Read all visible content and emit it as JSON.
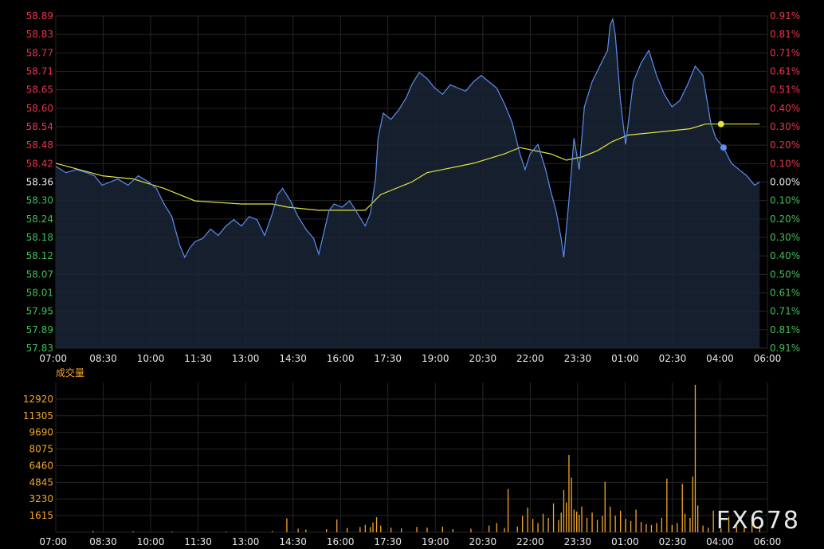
{
  "watermark": "FX678",
  "volume_title": "成交量",
  "colors": {
    "background": "#000000",
    "grid": "#262626",
    "price_line": "#5b8ff0",
    "price_fill": "#1a2535",
    "avg_line": "#e3e340",
    "up_label": "#e8344a",
    "down_label": "#3fbf5a",
    "neutral_label": "#e8e8e8",
    "volume_bar": "#f5a623"
  },
  "chart_data": [
    {
      "type": "line",
      "x_ticks": [
        "07:00",
        "08:30",
        "10:00",
        "11:30",
        "13:00",
        "14:30",
        "16:00",
        "17:30",
        "19:00",
        "20:30",
        "22:00",
        "23:30",
        "01:00",
        "02:30",
        "04:00",
        "06:00"
      ],
      "y_ticks_left": [
        "58.89",
        "58.83",
        "58.77",
        "58.71",
        "58.65",
        "58.60",
        "58.54",
        "58.48",
        "58.42",
        "58.36",
        "58.30",
        "58.24",
        "58.18",
        "58.12",
        "58.07",
        "58.01",
        "57.95",
        "57.89",
        "57.83"
      ],
      "y_ticks_right": [
        "0.91%",
        "0.81%",
        "0.71%",
        "0.61%",
        "0.51%",
        "0.40%",
        "0.30%",
        "0.20%",
        "0.10%",
        "0.00%",
        "0.10%",
        "0.20%",
        "0.30%",
        "0.40%",
        "0.50%",
        "0.61%",
        "0.71%",
        "0.81%",
        "0.91%"
      ],
      "ylim": [
        57.83,
        58.89
      ],
      "reference": 58.36,
      "series": [
        {
          "role": "price",
          "points": [
            [
              "07:00",
              58.41
            ],
            [
              "07:20",
              58.39
            ],
            [
              "07:40",
              58.4
            ],
            [
              "08:00",
              58.39
            ],
            [
              "08:15",
              58.38
            ],
            [
              "08:30",
              58.35
            ],
            [
              "08:45",
              58.36
            ],
            [
              "09:00",
              58.37
            ],
            [
              "09:20",
              58.35
            ],
            [
              "09:40",
              58.38
            ],
            [
              "10:00",
              58.36
            ],
            [
              "10:15",
              58.34
            ],
            [
              "10:30",
              58.29
            ],
            [
              "10:45",
              58.25
            ],
            [
              "11:00",
              58.16
            ],
            [
              "11:10",
              58.12
            ],
            [
              "11:20",
              58.15
            ],
            [
              "11:30",
              58.17
            ],
            [
              "11:45",
              58.18
            ],
            [
              "12:00",
              58.21
            ],
            [
              "12:15",
              58.19
            ],
            [
              "12:30",
              58.22
            ],
            [
              "12:45",
              58.24
            ],
            [
              "13:00",
              58.22
            ],
            [
              "13:15",
              58.25
            ],
            [
              "13:30",
              58.24
            ],
            [
              "13:45",
              58.19
            ],
            [
              "14:00",
              58.26
            ],
            [
              "14:10",
              58.32
            ],
            [
              "14:20",
              58.34
            ],
            [
              "14:35",
              58.3
            ],
            [
              "14:50",
              58.25
            ],
            [
              "15:05",
              58.21
            ],
            [
              "15:20",
              58.18
            ],
            [
              "15:30",
              58.13
            ],
            [
              "15:40",
              58.2
            ],
            [
              "15:50",
              58.27
            ],
            [
              "16:00",
              58.29
            ],
            [
              "16:15",
              58.28
            ],
            [
              "16:30",
              58.3
            ],
            [
              "16:45",
              58.26
            ],
            [
              "17:00",
              58.22
            ],
            [
              "17:10",
              58.26
            ],
            [
              "17:20",
              58.37
            ],
            [
              "17:25",
              58.5
            ],
            [
              "17:35",
              58.58
            ],
            [
              "17:50",
              58.56
            ],
            [
              "18:05",
              58.59
            ],
            [
              "18:20",
              58.63
            ],
            [
              "18:30",
              58.67
            ],
            [
              "18:45",
              58.71
            ],
            [
              "19:00",
              58.69
            ],
            [
              "19:15",
              58.66
            ],
            [
              "19:30",
              58.64
            ],
            [
              "19:45",
              58.67
            ],
            [
              "20:00",
              58.66
            ],
            [
              "20:15",
              58.65
            ],
            [
              "20:30",
              58.68
            ],
            [
              "20:45",
              58.7
            ],
            [
              "21:00",
              58.68
            ],
            [
              "21:15",
              58.66
            ],
            [
              "21:30",
              58.61
            ],
            [
              "21:45",
              58.55
            ],
            [
              "22:00",
              58.45
            ],
            [
              "22:10",
              58.4
            ],
            [
              "22:20",
              58.45
            ],
            [
              "22:35",
              58.48
            ],
            [
              "22:50",
              58.4
            ],
            [
              "23:00",
              58.33
            ],
            [
              "23:10",
              58.27
            ],
            [
              "23:20",
              58.18
            ],
            [
              "23:25",
              58.12
            ],
            [
              "23:35",
              58.3
            ],
            [
              "23:45",
              58.5
            ],
            [
              "23:55",
              58.4
            ],
            [
              "00:05",
              58.6
            ],
            [
              "00:20",
              58.68
            ],
            [
              "00:35",
              58.73
            ],
            [
              "00:50",
              58.78
            ],
            [
              "00:55",
              58.86
            ],
            [
              "01:00",
              58.88
            ],
            [
              "01:05",
              58.83
            ],
            [
              "01:15",
              58.62
            ],
            [
              "01:25",
              58.48
            ],
            [
              "01:40",
              58.68
            ],
            [
              "01:55",
              58.74
            ],
            [
              "02:10",
              58.78
            ],
            [
              "02:25",
              58.7
            ],
            [
              "02:40",
              58.64
            ],
            [
              "02:55",
              58.6
            ],
            [
              "03:10",
              58.62
            ],
            [
              "03:25",
              58.67
            ],
            [
              "03:40",
              58.73
            ],
            [
              "03:55",
              58.7
            ],
            [
              "04:10",
              58.55
            ],
            [
              "04:20",
              58.5
            ],
            [
              "04:35",
              58.47
            ],
            [
              "04:50",
              58.42
            ],
            [
              "05:05",
              58.4
            ],
            [
              "05:20",
              58.38
            ],
            [
              "05:35",
              58.35
            ],
            [
              "05:45",
              58.36
            ]
          ]
        },
        {
          "role": "average",
          "points": [
            [
              "07:00",
              58.42
            ],
            [
              "08:30",
              58.38
            ],
            [
              "09:30",
              58.37
            ],
            [
              "10:30",
              58.34
            ],
            [
              "11:30",
              58.3
            ],
            [
              "13:00",
              58.29
            ],
            [
              "14:00",
              58.29
            ],
            [
              "14:30",
              58.28
            ],
            [
              "15:30",
              58.27
            ],
            [
              "16:30",
              58.27
            ],
            [
              "17:00",
              58.27
            ],
            [
              "17:30",
              58.32
            ],
            [
              "18:30",
              58.36
            ],
            [
              "19:00",
              58.39
            ],
            [
              "19:30",
              58.4
            ],
            [
              "20:30",
              58.42
            ],
            [
              "21:30",
              58.45
            ],
            [
              "22:00",
              58.47
            ],
            [
              "22:30",
              58.46
            ],
            [
              "23:00",
              58.45
            ],
            [
              "23:30",
              58.43
            ],
            [
              "00:00",
              58.44
            ],
            [
              "00:30",
              58.46
            ],
            [
              "01:00",
              58.49
            ],
            [
              "01:30",
              58.51
            ],
            [
              "02:30",
              58.52
            ],
            [
              "03:30",
              58.53
            ],
            [
              "04:00",
              58.545
            ],
            [
              "04:30",
              58.545
            ],
            [
              "05:45",
              58.545
            ]
          ]
        }
      ]
    },
    {
      "type": "bar",
      "title": "成交量",
      "x_ticks": [
        "07:00",
        "08:30",
        "10:00",
        "11:30",
        "13:00",
        "14:30",
        "16:00",
        "17:30",
        "19:00",
        "20:30",
        "22:00",
        "23:30",
        "01:00",
        "02:30",
        "04:00",
        "06:00"
      ],
      "y_ticks": [
        "12920",
        "11305",
        "9690",
        "8075",
        "6460",
        "4845",
        "3230",
        "1615"
      ],
      "ylim": [
        0,
        14535
      ],
      "bars": [
        [
          "08:12",
          120
        ],
        [
          "09:30",
          90
        ],
        [
          "10:45",
          70
        ],
        [
          "12:30",
          60
        ],
        [
          "14:00",
          110
        ],
        [
          "14:28",
          1350
        ],
        [
          "14:50",
          350
        ],
        [
          "15:05",
          260
        ],
        [
          "15:45",
          300
        ],
        [
          "16:05",
          1250
        ],
        [
          "16:25",
          420
        ],
        [
          "16:50",
          520
        ],
        [
          "17:00",
          720
        ],
        [
          "17:10",
          520
        ],
        [
          "17:15",
          950
        ],
        [
          "17:22",
          1450
        ],
        [
          "17:30",
          650
        ],
        [
          "17:50",
          450
        ],
        [
          "18:10",
          380
        ],
        [
          "18:40",
          520
        ],
        [
          "19:00",
          450
        ],
        [
          "19:30",
          550
        ],
        [
          "19:50",
          300
        ],
        [
          "20:25",
          350
        ],
        [
          "21:00",
          650
        ],
        [
          "21:15",
          900
        ],
        [
          "21:30",
          420
        ],
        [
          "21:37",
          4200
        ],
        [
          "21:55",
          550
        ],
        [
          "22:05",
          1600
        ],
        [
          "22:15",
          2400
        ],
        [
          "22:25",
          1300
        ],
        [
          "22:35",
          900
        ],
        [
          "22:45",
          1800
        ],
        [
          "22:55",
          1400
        ],
        [
          "23:05",
          2800
        ],
        [
          "23:15",
          1200
        ],
        [
          "23:20",
          1900
        ],
        [
          "23:25",
          4100
        ],
        [
          "23:30",
          2900
        ],
        [
          "23:35",
          7500
        ],
        [
          "23:40",
          5300
        ],
        [
          "23:45",
          2200
        ],
        [
          "23:50",
          2000
        ],
        [
          "23:55",
          1700
        ],
        [
          "00:00",
          2500
        ],
        [
          "00:10",
          1400
        ],
        [
          "00:20",
          1900
        ],
        [
          "00:30",
          1200
        ],
        [
          "00:40",
          1600
        ],
        [
          "00:45",
          4900
        ],
        [
          "00:55",
          2500
        ],
        [
          "01:05",
          1600
        ],
        [
          "01:15",
          2100
        ],
        [
          "01:25",
          1300
        ],
        [
          "01:35",
          1100
        ],
        [
          "01:45",
          2200
        ],
        [
          "01:55",
          1000
        ],
        [
          "02:05",
          800
        ],
        [
          "02:15",
          700
        ],
        [
          "02:25",
          900
        ],
        [
          "02:35",
          1400
        ],
        [
          "02:45",
          5200
        ],
        [
          "02:55",
          700
        ],
        [
          "03:05",
          900
        ],
        [
          "03:15",
          4700
        ],
        [
          "03:20",
          1800
        ],
        [
          "03:30",
          1400
        ],
        [
          "03:35",
          5400
        ],
        [
          "03:40",
          14300
        ],
        [
          "03:45",
          2600
        ],
        [
          "03:55",
          650
        ],
        [
          "04:05",
          450
        ],
        [
          "04:15",
          2100
        ],
        [
          "04:30",
          350
        ],
        [
          "04:45",
          1500
        ],
        [
          "05:00",
          600
        ],
        [
          "05:15",
          450
        ],
        [
          "05:30",
          1300
        ],
        [
          "05:45",
          650
        ]
      ]
    }
  ]
}
